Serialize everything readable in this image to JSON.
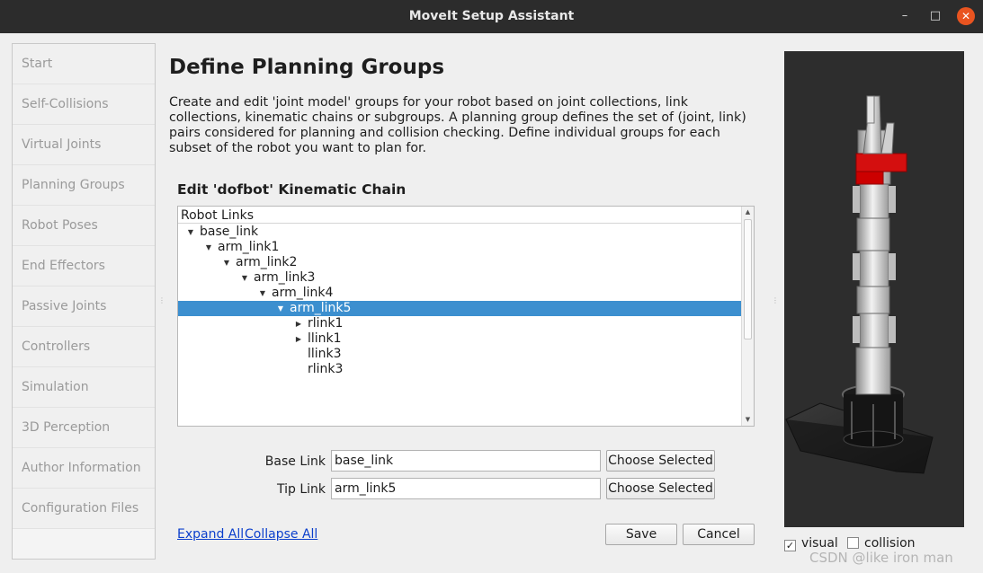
{
  "window": {
    "title": "MoveIt Setup Assistant",
    "min_glyph": "–",
    "max_glyph": "□",
    "close_glyph": "✕"
  },
  "sidebar": {
    "items": [
      {
        "label": "Start"
      },
      {
        "label": "Self-Collisions"
      },
      {
        "label": "Virtual Joints"
      },
      {
        "label": "Planning Groups"
      },
      {
        "label": "Robot Poses"
      },
      {
        "label": "End Effectors"
      },
      {
        "label": "Passive Joints"
      },
      {
        "label": "Controllers"
      },
      {
        "label": "Simulation"
      },
      {
        "label": "3D Perception"
      },
      {
        "label": "Author Information"
      },
      {
        "label": "Configuration Files"
      }
    ]
  },
  "main": {
    "title": "Define Planning Groups",
    "description": "Create and edit 'joint model' groups for your robot based on joint collections, link collections, kinematic chains or subgroups. A planning group defines the set of (joint, link) pairs considered for planning and collision checking. Define individual groups for each subset of the robot you want to plan for.",
    "section_title": "Edit 'dofbot' Kinematic Chain",
    "tree": {
      "header": "Robot Links",
      "rows": [
        {
          "label": "base_link",
          "level": 0,
          "arrow": "▼",
          "selected": false
        },
        {
          "label": "arm_link1",
          "level": 1,
          "arrow": "▼",
          "selected": false
        },
        {
          "label": "arm_link2",
          "level": 2,
          "arrow": "▼",
          "selected": false
        },
        {
          "label": "arm_link3",
          "level": 3,
          "arrow": "▼",
          "selected": false
        },
        {
          "label": "arm_link4",
          "level": 4,
          "arrow": "▼",
          "selected": false
        },
        {
          "label": "arm_link5",
          "level": 5,
          "arrow": "▼",
          "selected": true
        },
        {
          "label": "rlink1",
          "level": 6,
          "arrow": "▶",
          "selected": false
        },
        {
          "label": "llink1",
          "level": 6,
          "arrow": "▶",
          "selected": false
        },
        {
          "label": "llink3",
          "level": 6,
          "arrow": "",
          "selected": false
        },
        {
          "label": "rlink3",
          "level": 6,
          "arrow": "",
          "selected": false
        }
      ]
    },
    "base_link": {
      "label": "Base Link",
      "value": "base_link",
      "button": "Choose Selected"
    },
    "tip_link": {
      "label": "Tip Link",
      "value": "arm_link5",
      "button": "Choose Selected"
    },
    "expand_all": "Expand All",
    "collapse_all": "Collapse All",
    "save_button": "Save",
    "cancel_button": "Cancel"
  },
  "viewer": {
    "visual_label": "visual",
    "visual_checked": true,
    "collision_label": "collision",
    "collision_checked": false,
    "check_glyph": "✓"
  },
  "watermark": "CSDN @like iron man",
  "colors": {
    "selection": "#3c8fcf",
    "link": "#0b3fcc",
    "close_button": "#e95420",
    "gripper_highlight": "#d40f0f"
  }
}
